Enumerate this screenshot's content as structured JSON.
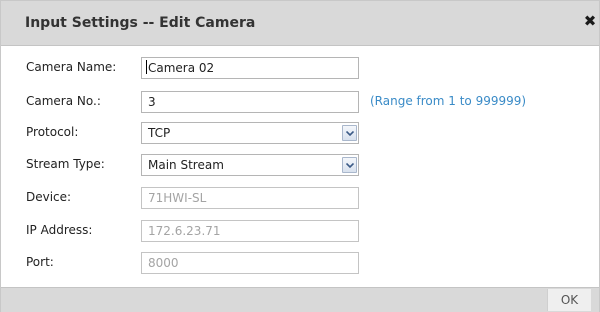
{
  "dialog": {
    "title": "Input Settings -- Edit Camera",
    "close_icon": "close-icon",
    "ok_label": "OK"
  },
  "form": {
    "camera_name": {
      "label": "Camera Name:",
      "value": "Camera 02"
    },
    "camera_no": {
      "label": "Camera No.:",
      "value": "3",
      "hint": "(Range from 1 to 999999)"
    },
    "protocol": {
      "label": "Protocol:",
      "value": "TCP",
      "icon": "chevron-down-icon"
    },
    "stream_type": {
      "label": "Stream Type:",
      "value": "Main Stream",
      "icon": "chevron-down-icon"
    },
    "device": {
      "label": "Device:",
      "value": "71HWI-SL"
    },
    "ip_address": {
      "label": "IP Address:",
      "value": "172.6.23.71"
    },
    "port": {
      "label": "Port:",
      "value": "8000"
    }
  },
  "colors": {
    "titlebar": "#d9d9d9",
    "hint": "#3a8bc7",
    "disabled_text": "#a4a4a4"
  }
}
